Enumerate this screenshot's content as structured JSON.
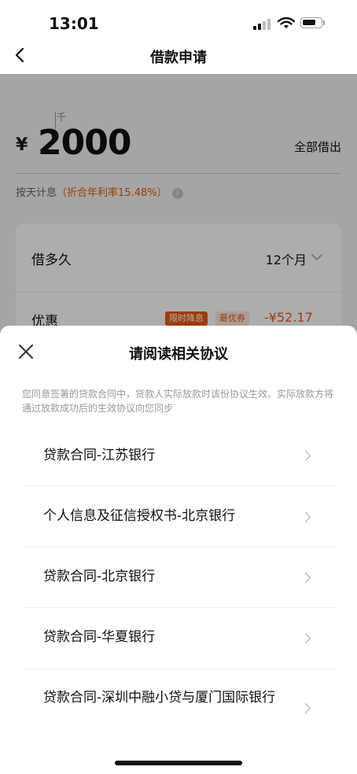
{
  "status_bar": {
    "time": "13:01"
  },
  "nav": {
    "title": "借款申请"
  },
  "loan": {
    "unit_hint": "千",
    "currency": "¥",
    "amount": "2000",
    "borrow_all": "全部借出",
    "interest_prefix": "按天计息",
    "interest_rate": "（折合年利率15.48%）",
    "info_icon": "i"
  },
  "term": {
    "label": "借多久",
    "value": "12个月"
  },
  "discount": {
    "label": "优惠",
    "badge_limited": "限时降息",
    "badge_coupon": "最优券",
    "amount": "-¥52.17"
  },
  "sheet": {
    "title": "请阅读相关协议",
    "description": "您同意签署的贷款合同中，贷款人实际放款时该份协议生效。实际放款方将通过放款成功后的生效协议向您同步",
    "agreements": [
      {
        "label": "贷款合同-江苏银行"
      },
      {
        "label": "个人信息及征信授权书-北京银行"
      },
      {
        "label": "贷款合同-北京银行"
      },
      {
        "label": "贷款合同-华夏银行"
      },
      {
        "label": "贷款合同-深圳中融小贷与厦门国际银行"
      }
    ]
  },
  "colors": {
    "accent": "#e8590c",
    "overlay": "rgba(0,0,0,0.32)"
  },
  "icons": {
    "back": "chevron-left-icon",
    "close": "close-icon",
    "row_arrow": "chevron-right-icon",
    "dropdown": "chevron-down-icon",
    "info": "info-icon"
  }
}
